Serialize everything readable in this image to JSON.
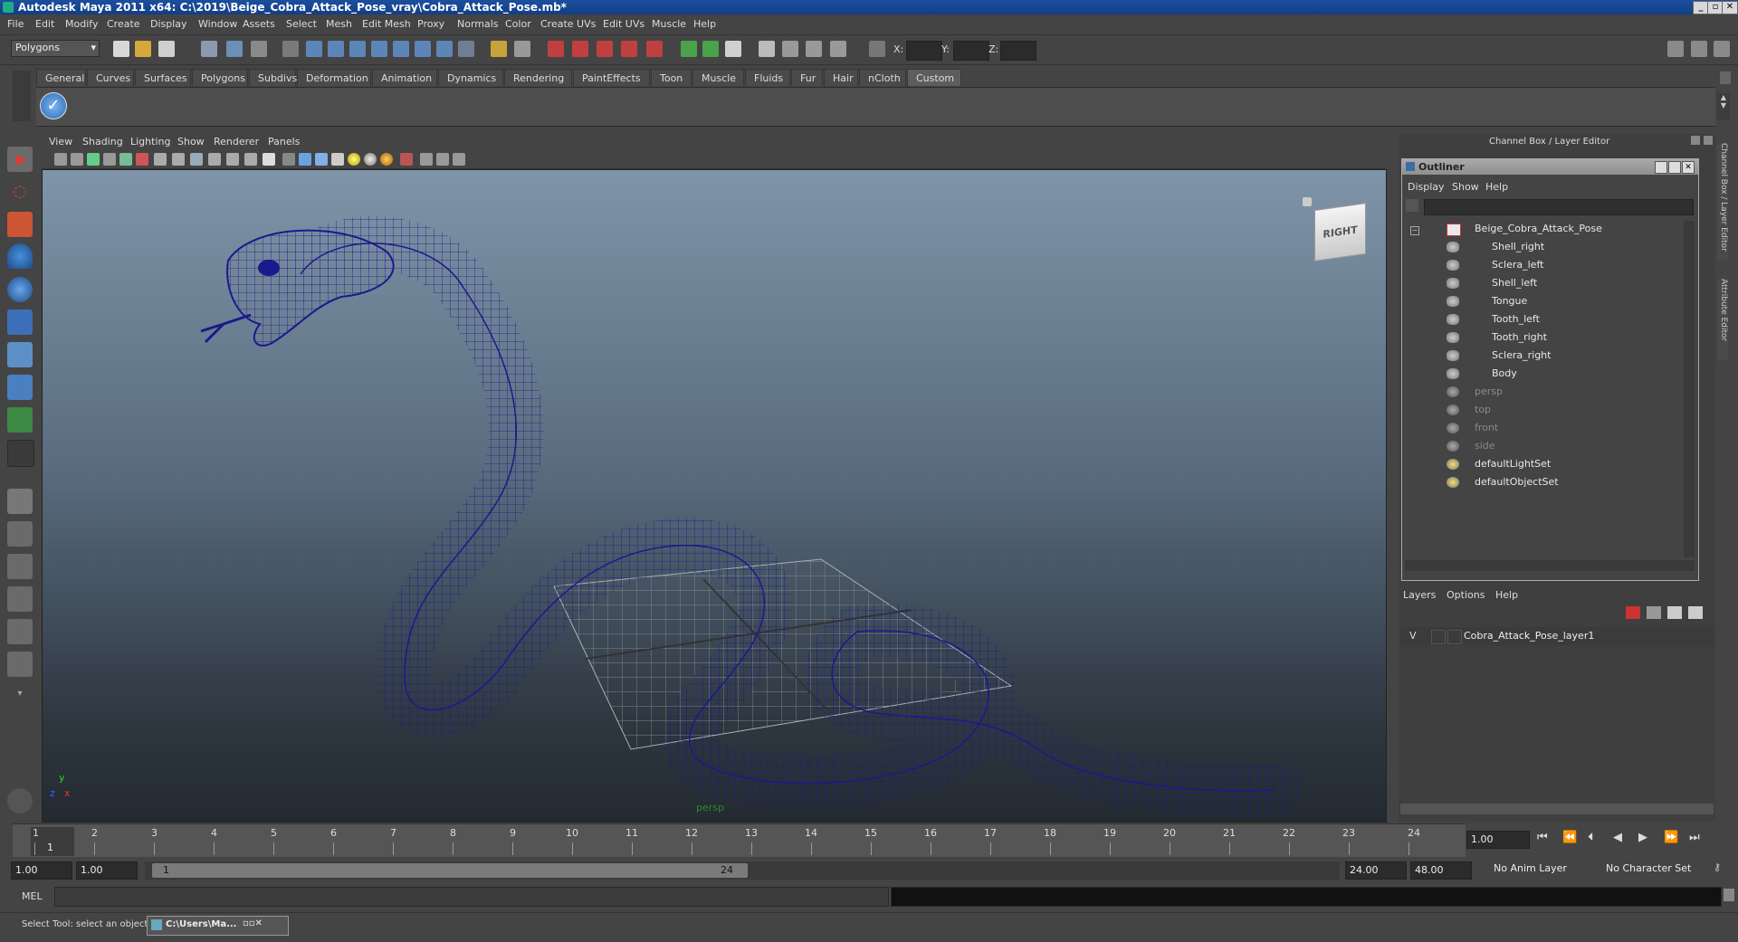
{
  "window": {
    "title": "Autodesk Maya 2011 x64: C:\\2019\\Beige_Cobra_Attack_Pose_vray\\Cobra_Attack_Pose.mb*"
  },
  "menubar": [
    "File",
    "Edit",
    "Modify",
    "Create",
    "Display",
    "Window",
    "Assets",
    "Select",
    "Mesh",
    "Edit Mesh",
    "Proxy",
    "Normals",
    "Color",
    "Create UVs",
    "Edit UVs",
    "Muscle",
    "Help"
  ],
  "statusline": {
    "mode": "Polygons",
    "x_label": "X:",
    "y_label": "Y:",
    "z_label": "Z:"
  },
  "shelf": {
    "tabs": [
      "General",
      "Curves",
      "Surfaces",
      "Polygons",
      "Subdivs",
      "Deformation",
      "Animation",
      "Dynamics",
      "Rendering",
      "PaintEffects",
      "Toon",
      "Muscle",
      "Fluids",
      "Fur",
      "Hair",
      "nCloth",
      "Custom"
    ],
    "active": "Custom"
  },
  "viewport": {
    "menu": [
      "View",
      "Shading",
      "Lighting",
      "Show",
      "Renderer",
      "Panels"
    ],
    "camera_label": "persp",
    "viewcube_label": "RIGHT",
    "axis_y": "y",
    "axis_x": "x",
    "axis_z": "z"
  },
  "right_panel": {
    "header": "Channel Box / Layer Editor",
    "side_tab_1": "Channel Box / Layer Editor",
    "side_tab_2": "Attribute Editor"
  },
  "outliner": {
    "title": "Outliner",
    "menu": [
      "Display",
      "Show",
      "Help"
    ],
    "root": "Beige_Cobra_Attack_Pose",
    "children": [
      "Shell_right",
      "Sclera_left",
      "Shell_left",
      "Tongue",
      "Tooth_left",
      "Tooth_right",
      "Sclera_right",
      "Body"
    ],
    "cameras": [
      "persp",
      "top",
      "front",
      "side"
    ],
    "sets": [
      "defaultLightSet",
      "defaultObjectSet"
    ]
  },
  "layers": {
    "menu": [
      "Layers",
      "Options",
      "Help"
    ],
    "layer_visibility": "V",
    "layer_name": "Cobra_Attack_Pose_layer1"
  },
  "timeline": {
    "frames": [
      "1",
      "2",
      "3",
      "4",
      "5",
      "6",
      "7",
      "8",
      "9",
      "10",
      "11",
      "12",
      "13",
      "14",
      "15",
      "16",
      "17",
      "18",
      "19",
      "20",
      "21",
      "22",
      "23",
      "24"
    ],
    "current_frame_marker": "1",
    "current_time": "1.00"
  },
  "range": {
    "start_field": "1.00",
    "anim_start": "1.00",
    "slider_start": "1",
    "slider_end": "24",
    "anim_end": "24.00",
    "range_end": "48.00",
    "anim_layer": "No Anim Layer",
    "character_set": "No Character Set"
  },
  "command": {
    "label": "MEL"
  },
  "help": {
    "text": "Select Tool: select an object",
    "task_label": "C:\\Users\\Ma..."
  },
  "colors": {
    "wireframe": "#1a1a8c",
    "accent": "#1f4f9e"
  }
}
